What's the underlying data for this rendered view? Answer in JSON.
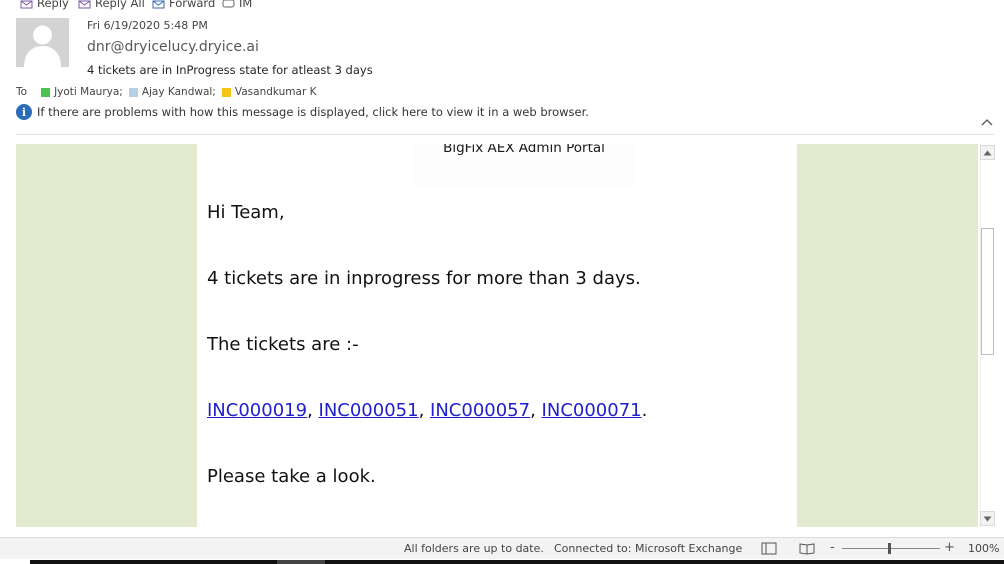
{
  "toolbar": {
    "reply_label": "Reply",
    "reply_all_label": "Reply All",
    "forward_label": "Forward",
    "im_label": "IM"
  },
  "header": {
    "date": "Fri 6/19/2020 5:48 PM",
    "from": "dnr@dryicelucy.dryice.ai",
    "subject": "4 tickets are in InProgress state for atleast 3 days",
    "to_label": "To",
    "recipients": [
      {
        "name": "Jyoti Maurya;",
        "color": "#4cc24c"
      },
      {
        "name": "Ajay Kandwal;",
        "color": "#b7cfe0"
      },
      {
        "name": "Vasandkumar K",
        "color": "#f5c518"
      }
    ],
    "info_message": "If there are problems with how this message is displayed, click here to view it in a web browser."
  },
  "message": {
    "banner": "BigFix AEX Admin Portal",
    "greeting": "Hi Team,",
    "line1": "4 tickets are in inprogress for more than 3 days.",
    "line2": "The tickets are :-",
    "tickets": [
      "INC000019",
      "INC000051",
      "INC000057",
      "INC000071"
    ],
    "sep": ", ",
    "end": ".",
    "closing": "Please take a look."
  },
  "statusbar": {
    "sync_status": "All folders are up to date.",
    "connection": "Connected to: Microsoft Exchange",
    "zoom_minus": "-",
    "zoom_plus": "+",
    "zoom_level": "100%"
  },
  "colors": {
    "sidebar_green": "#e2ead0",
    "link_blue": "#1f1fcc",
    "info_blue": "#2b6cb8"
  }
}
